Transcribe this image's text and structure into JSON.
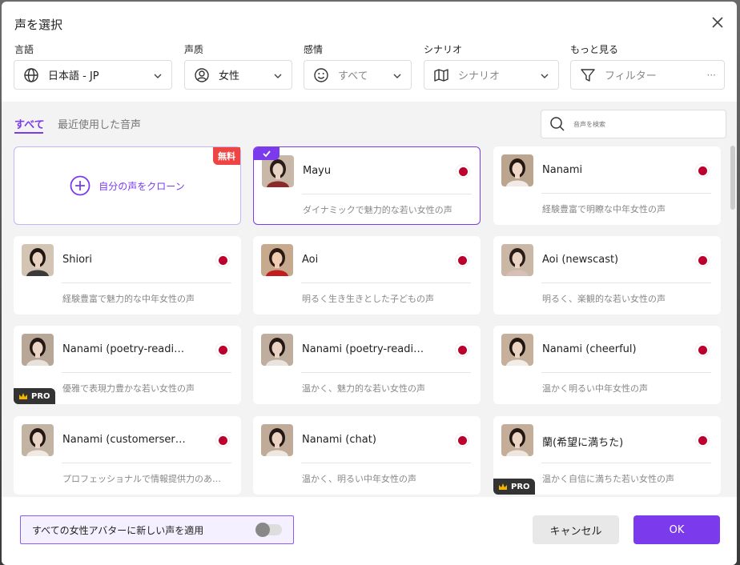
{
  "dialog": {
    "title": "声を選択"
  },
  "filters": {
    "language": {
      "label": "言語",
      "value": "日本語 - JP",
      "icon": "globe-icon"
    },
    "quality": {
      "label": "声质",
      "value": "女性",
      "icon": "user-icon"
    },
    "emotion": {
      "label": "感情",
      "value": "すべて",
      "icon": "smile-icon"
    },
    "scenario": {
      "label": "シナリオ",
      "value": "シナリオ",
      "icon": "map-icon"
    },
    "more": {
      "label": "もっと見る",
      "value": "フィルター",
      "icon": "filter-icon",
      "extra": "···"
    }
  },
  "tabs": [
    {
      "label": "すべて",
      "active": true
    },
    {
      "label": "最近使用した音声",
      "active": false
    }
  ],
  "search": {
    "placeholder": "音声を検索"
  },
  "clone_card": {
    "label": "自分の声をクローン",
    "badge": "無料"
  },
  "voices": [
    {
      "name": "Mayu",
      "desc": "ダイナミックで魅力的な若い女性の声",
      "selected": true,
      "pro": false,
      "flag": "japan-flag"
    },
    {
      "name": "Nanami",
      "desc": "経験豊富で明瞭な中年女性の声",
      "selected": false,
      "pro": false,
      "flag": "japan-flag"
    },
    {
      "name": "Shiori",
      "desc": "経験豊富で魅力的な中年女性の声",
      "selected": false,
      "pro": false,
      "flag": "japan-flag"
    },
    {
      "name": "Aoi",
      "desc": "明るく生き生きとした子どもの声",
      "selected": false,
      "pro": false,
      "flag": "japan-flag"
    },
    {
      "name": "Aoi (newscast)",
      "desc": "明るく、楽観的な若い女性の声",
      "selected": false,
      "pro": false,
      "flag": "japan-flag"
    },
    {
      "name": "Nanami (poetry-readi…",
      "desc": "優雅で表現力豊かな若い女性の声",
      "selected": false,
      "pro": true,
      "flag": "japan-flag"
    },
    {
      "name": "Nanami (poetry-readi…",
      "desc": "温かく、魅力的な若い女性の声",
      "selected": false,
      "pro": false,
      "flag": "japan-flag"
    },
    {
      "name": "Nanami (cheerful)",
      "desc": "温かく明るい中年女性の声",
      "selected": false,
      "pro": false,
      "flag": "japan-flag"
    },
    {
      "name": "Nanami (customerser…",
      "desc": "プロフェッショナルで情報提供力のあ…",
      "selected": false,
      "pro": false,
      "flag": "japan-flag"
    },
    {
      "name": "Nanami (chat)",
      "desc": "温かく、明るい中年女性の声",
      "selected": false,
      "pro": false,
      "flag": "japan-flag"
    },
    {
      "name": "蘭(希望に満ちた)",
      "desc": "温かく自信に満ちた若い女性の声",
      "selected": false,
      "pro": true,
      "flag": "japan-flag"
    }
  ],
  "pro_label": "PRO",
  "footer": {
    "apply_label": "すべての女性アバターに新しい声を適用",
    "apply_enabled": false,
    "cancel_label": "キャンセル",
    "ok_label": "OK"
  },
  "colors": {
    "accent": "#7c3aed",
    "free_badge": "#ef4444",
    "japan_red": "#bc002d"
  }
}
